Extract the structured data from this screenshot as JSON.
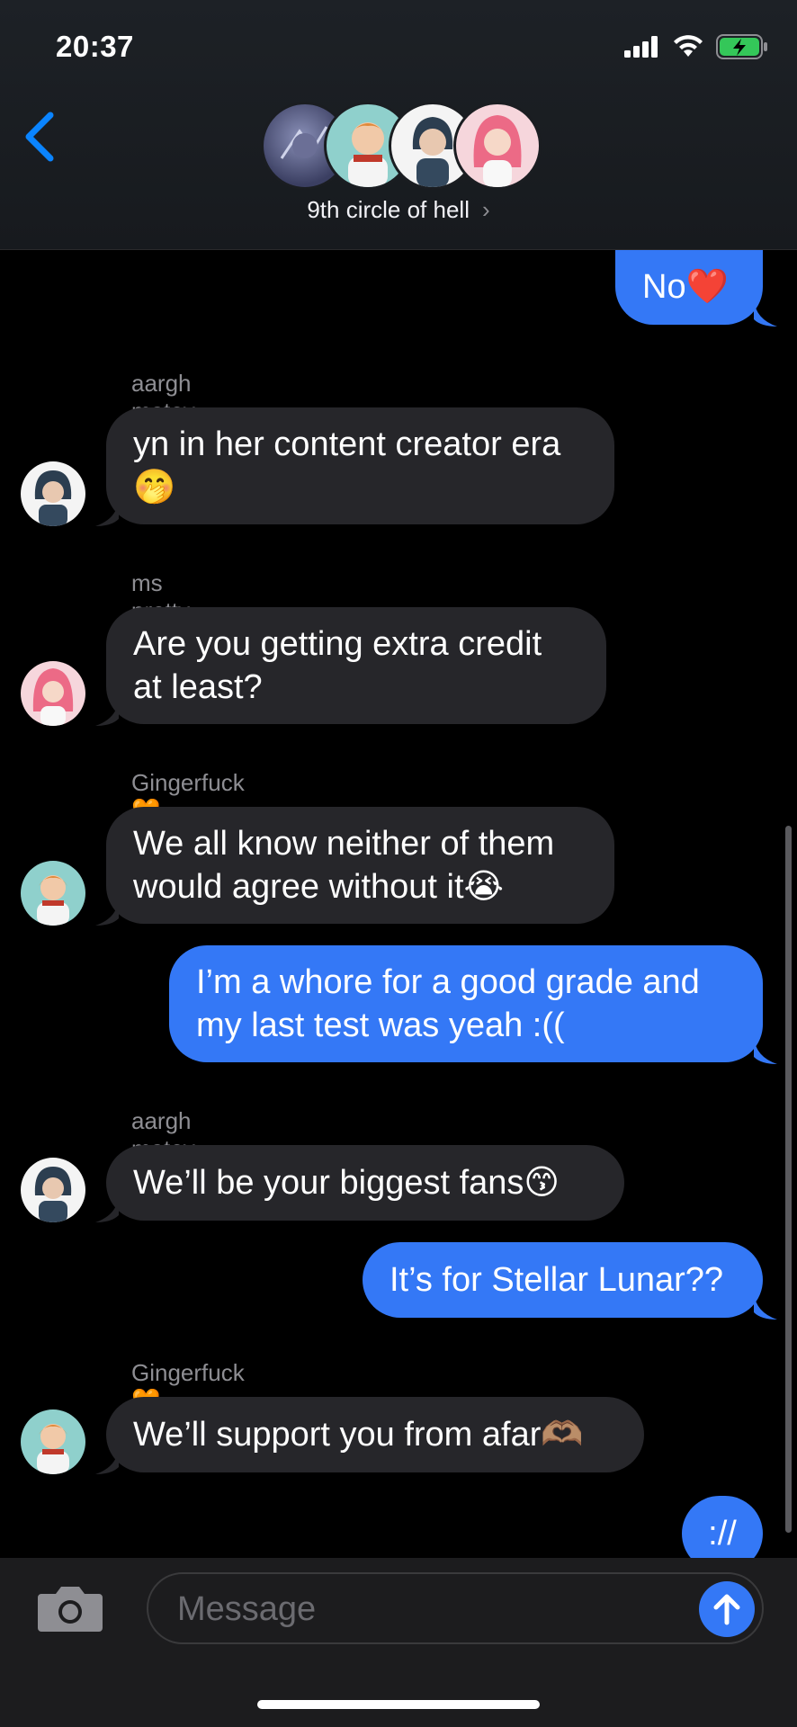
{
  "status_bar": {
    "time": "20:37"
  },
  "header": {
    "group_name": "9th circle of hell",
    "chevron": "›",
    "avatar_icons": [
      "group-photo-icon",
      "ginger-avatar-icon",
      "dark-hair-avatar-icon",
      "pink-hair-avatar-icon"
    ]
  },
  "messages": [
    {
      "dir": "out",
      "text": "No❤️"
    },
    {
      "dir": "in",
      "sender": "aargh matey🏴‍☠️",
      "lines": [
        "yn in her content creator era",
        "🤭"
      ]
    },
    {
      "dir": "in",
      "sender": "ms pretty in pink💞",
      "lines": [
        "Are you getting extra credit",
        "at least?"
      ]
    },
    {
      "dir": "in",
      "sender": "Gingerfuck🧡",
      "lines": [
        "We all know neither of them",
        "would agree without it😭"
      ]
    },
    {
      "dir": "out",
      "lines": [
        "I’m a whore for a good grade and",
        "my last test was yeah :(("
      ]
    },
    {
      "dir": "in",
      "sender": "aargh matey🏴‍☠️",
      "text": "We’ll be your biggest fans😙"
    },
    {
      "dir": "out",
      "text": "It’s for Stellar Lunar??"
    },
    {
      "dir": "in",
      "sender": "Gingerfuck🧡",
      "text": "We’ll support you from afar🫶🏽"
    },
    {
      "dir": "out",
      "text": "://"
    }
  ],
  "composer": {
    "placeholder": "Message"
  },
  "colors": {
    "outgoing": "#3478f6",
    "incoming": "#26262a",
    "background": "#000000",
    "accent": "#0a84ff"
  }
}
